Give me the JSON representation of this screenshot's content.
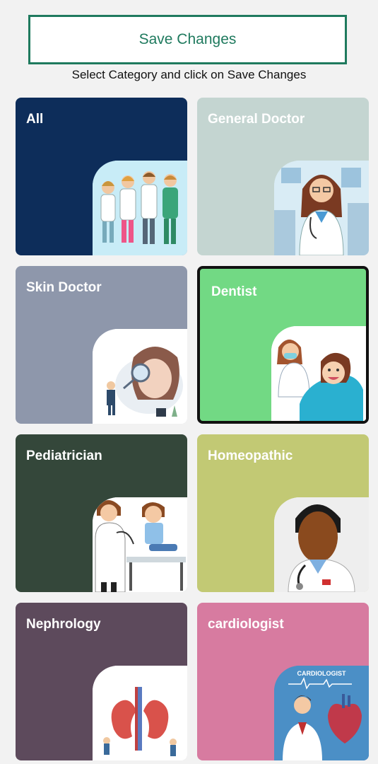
{
  "header": {
    "save_label": "Save Changes",
    "hint": "Select Category and click on Save Changes"
  },
  "categories": [
    {
      "label": "All",
      "color": "#0d2d5a",
      "selected": false,
      "illustration": "group-of-doctors-icon"
    },
    {
      "label": "General Doctor",
      "color": "#c4d5d1",
      "selected": false,
      "illustration": "female-doctor-icon"
    },
    {
      "label": "Skin Doctor",
      "color": "#8e97ab",
      "selected": false,
      "illustration": "skin-exam-icon"
    },
    {
      "label": "Dentist",
      "color": "#72d984",
      "selected": true,
      "illustration": "dentist-with-child-icon"
    },
    {
      "label": "Pediatrician",
      "color": "#34473a",
      "selected": false,
      "illustration": "pediatrician-with-child-icon"
    },
    {
      "label": "Homeopathic",
      "color": "#c2c974",
      "selected": false,
      "illustration": "doctor-stethoscope-icon"
    },
    {
      "label": "Nephrology",
      "color": "#5d4a5c",
      "selected": false,
      "illustration": "kidney-icon"
    },
    {
      "label": "cardiologist",
      "color": "#d77ba0",
      "selected": false,
      "illustration": "heart-icon",
      "poster_text": "CARDIOLOGIST"
    }
  ]
}
